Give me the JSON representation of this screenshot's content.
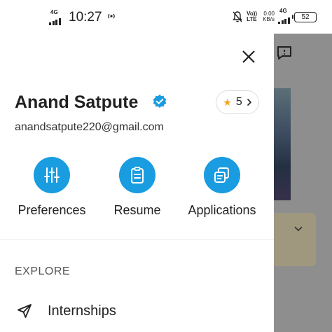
{
  "status_bar": {
    "network_left": "4G",
    "time": "10:27",
    "hotspot_icon": "hotspot-icon",
    "volte": "Vo)) LTE",
    "speed_value": "0.00",
    "speed_unit": "KB/s",
    "network_right": "4G",
    "battery": "52"
  },
  "drawer": {
    "user_name": "Anand Satpute",
    "email": "anandsatpute220@gmail.com",
    "rating": "5",
    "rating_icon": "star-icon",
    "verified_icon": "verified-badge-icon",
    "close_icon": "close-icon",
    "actions": [
      {
        "label": "Preferences",
        "icon": "sliders-icon"
      },
      {
        "label": "Resume",
        "icon": "clipboard-icon"
      },
      {
        "label": "Applications",
        "icon": "documents-icon"
      }
    ],
    "section_title": "EXPLORE",
    "menu": [
      {
        "label": "Internships",
        "icon": "send-icon"
      }
    ]
  },
  "colors": {
    "accent": "#1a9ce0",
    "star": "#f2a31b",
    "overlay": "#8e8e8e"
  }
}
